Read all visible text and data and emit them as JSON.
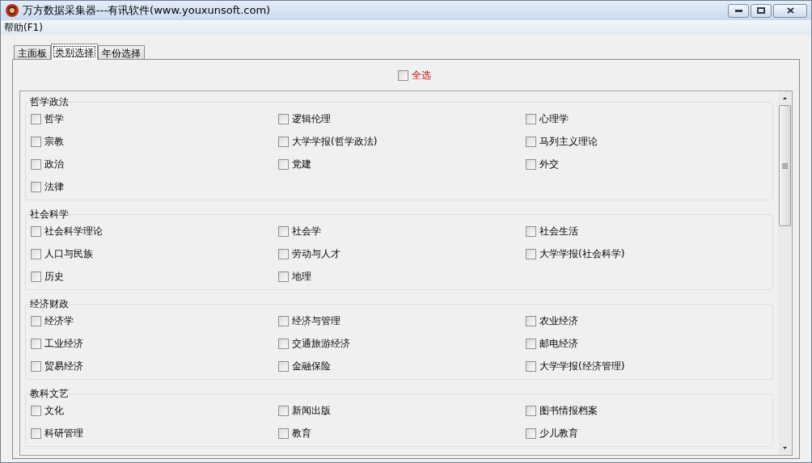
{
  "window": {
    "title": "万方数据采集器---有讯软件(www.youxunsoft.com)"
  },
  "menu": [
    "帮助(F1)"
  ],
  "tabs": [
    {
      "label": "主面板",
      "selected": false
    },
    {
      "label": "类别选择",
      "selected": true
    },
    {
      "label": "年份选择",
      "selected": false
    }
  ],
  "select_all": {
    "label": "全选",
    "checked": false
  },
  "groups": [
    {
      "title": "哲学政法",
      "items": [
        {
          "label": "哲学",
          "checked": false
        },
        {
          "label": "逻辑伦理",
          "checked": false
        },
        {
          "label": "心理学",
          "checked": false
        },
        {
          "label": "宗教",
          "checked": false
        },
        {
          "label": "大学学报(哲学政法)",
          "checked": false
        },
        {
          "label": "马列主义理论",
          "checked": false
        },
        {
          "label": "政治",
          "checked": false
        },
        {
          "label": "党建",
          "checked": false
        },
        {
          "label": "外交",
          "checked": false
        },
        {
          "label": "法律",
          "checked": false
        }
      ]
    },
    {
      "title": "社会科学",
      "items": [
        {
          "label": "社会科学理论",
          "checked": false
        },
        {
          "label": "社会学",
          "checked": false
        },
        {
          "label": "社会生活",
          "checked": false
        },
        {
          "label": "人口与民族",
          "checked": false
        },
        {
          "label": "劳动与人才",
          "checked": false
        },
        {
          "label": "大学学报(社会科学)",
          "checked": false
        },
        {
          "label": "历史",
          "checked": false
        },
        {
          "label": "地理",
          "checked": false
        }
      ]
    },
    {
      "title": "经济财政",
      "items": [
        {
          "label": "经济学",
          "checked": false
        },
        {
          "label": "经济与管理",
          "checked": false
        },
        {
          "label": "农业经济",
          "checked": false
        },
        {
          "label": "工业经济",
          "checked": false
        },
        {
          "label": "交通旅游经济",
          "checked": false
        },
        {
          "label": "邮电经济",
          "checked": false
        },
        {
          "label": "贸易经济",
          "checked": false
        },
        {
          "label": "金融保险",
          "checked": false
        },
        {
          "label": "大学学报(经济管理)",
          "checked": false
        }
      ]
    },
    {
      "title": "教科文艺",
      "items": [
        {
          "label": "文化",
          "checked": false
        },
        {
          "label": "新闻出版",
          "checked": false
        },
        {
          "label": "图书情报档案",
          "checked": false
        },
        {
          "label": "科研管理",
          "checked": false
        },
        {
          "label": "教育",
          "checked": false
        },
        {
          "label": "少儿教育",
          "checked": false
        }
      ]
    }
  ]
}
